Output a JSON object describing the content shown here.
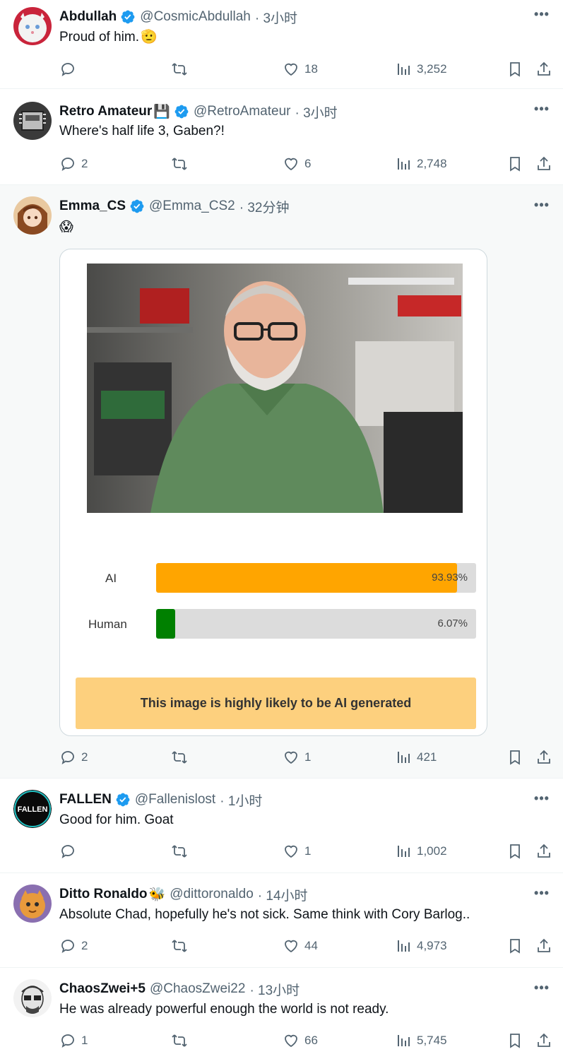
{
  "tweets": [
    {
      "name": "Abdullah",
      "verified": true,
      "name_emoji": "",
      "handle": "@CosmicAbdullah",
      "time": "· 3小时",
      "text": "Proud of him.",
      "text_emoji": "🫡",
      "replies": "",
      "retweets": "",
      "likes": "18",
      "views": "3,252",
      "avatar": "white-cat-avatar"
    },
    {
      "name": "Retro Amateur",
      "verified": true,
      "name_emoji": "💾",
      "handle": "@RetroAmateur",
      "time": "· 3小时",
      "text": "Where's half life 3, Gaben?!",
      "text_emoji": "",
      "replies": "2",
      "retweets": "",
      "likes": "6",
      "views": "2,748",
      "avatar": "retro-chip-avatar"
    },
    {
      "name": "Emma_CS",
      "verified": true,
      "name_emoji": "",
      "handle": "@Emma_CS2",
      "time": "· 32分钟",
      "text": "",
      "text_emoji": "😱",
      "replies": "2",
      "retweets": "",
      "likes": "1",
      "views": "421",
      "avatar": "anime-girl-avatar",
      "detector": {
        "rows": [
          {
            "label": "AI",
            "value": "93.93%",
            "fraction": 0.9393,
            "color": "#ffa500"
          },
          {
            "label": "Human",
            "value": "6.07%",
            "fraction": 0.0607,
            "color": "#008000"
          }
        ],
        "verdict": "This image is highly likely to be AI generated"
      }
    },
    {
      "name": "FALLEN",
      "verified": true,
      "name_emoji": "",
      "handle": "@Fallenislost",
      "time": "· 1小时",
      "text": "Good for him. Goat",
      "text_emoji": "",
      "replies": "",
      "retweets": "",
      "likes": "1",
      "views": "1,002",
      "avatar": "fallen-logo-avatar"
    },
    {
      "name": "Ditto Ronaldo",
      "verified": false,
      "name_emoji": "🐝",
      "handle": "@dittoronaldo",
      "time": "· 14小时",
      "text": "Absolute Chad, hopefully he's not sick. Same think with Cory Barlog..",
      "text_emoji": "",
      "replies": "2",
      "retweets": "",
      "likes": "44",
      "views": "4,973",
      "avatar": "cartoon-cat-avatar"
    },
    {
      "name": "ChaosZwei+5",
      "verified": false,
      "name_emoji": "",
      "handle": "@ChaosZwei22",
      "time": "· 13小时",
      "text": "He was already powerful enough the world is not ready.",
      "text_emoji": "",
      "replies": "1",
      "retweets": "",
      "likes": "66",
      "views": "5,745",
      "avatar": "sketch-man-avatar"
    }
  ],
  "icons": {
    "more": "more-icon",
    "reply": "reply-icon",
    "retweet": "retweet-icon",
    "like": "heart-icon",
    "views": "views-icon",
    "bookmark": "bookmark-icon",
    "share": "share-icon",
    "verified": "verified-badge-icon"
  },
  "colors": {
    "verified": "#1d9bf0",
    "muted": "#536471",
    "ai_bar": "#ffa500",
    "human_bar": "#008000",
    "verdict_bg": "#fdd07e"
  }
}
